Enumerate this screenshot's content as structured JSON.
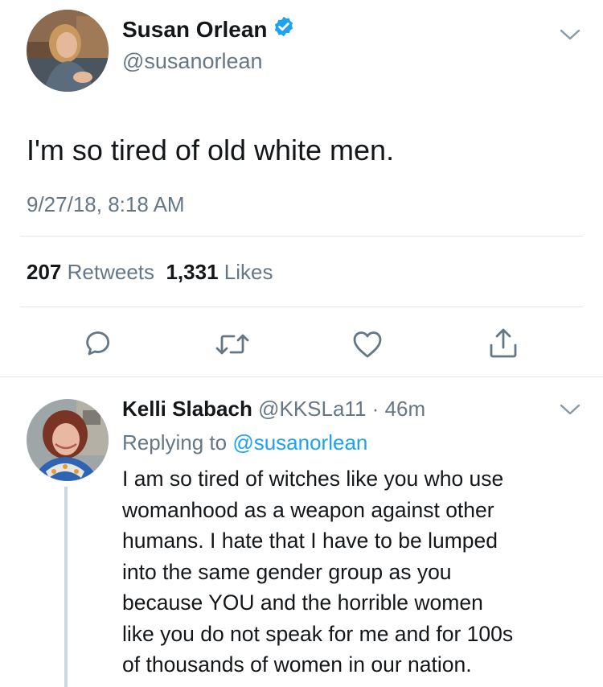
{
  "main_tweet": {
    "author_name": "Susan Orlean",
    "author_handle": "@susanorlean",
    "verified": true,
    "text": "I'm so tired of old white men.",
    "timestamp": "9/27/18, 8:18 AM",
    "retweet_count": "207",
    "retweet_label": "Retweets",
    "like_count": "1,331",
    "like_label": "Likes"
  },
  "actions": [
    "reply-icon",
    "retweet-icon",
    "like-icon",
    "share-icon"
  ],
  "reply": {
    "author_name": "Kelli Slabach",
    "author_handle": "@KKSLa11",
    "separator": "·",
    "time_ago": "46m",
    "replying_prefix": "Replying to",
    "replying_to": "@susanorlean",
    "text_lines": [
      "I am so tired of witches like you who use",
      "womanhood as a weapon against other",
      "humans. I hate that I have to be lumped",
      "into the same gender group as you",
      "because YOU and the horrible women",
      "like you do not speak for me and for 100s",
      "of thousands of women in our nation."
    ]
  },
  "colors": {
    "text_primary": "#14171a",
    "text_secondary": "#657786",
    "link": "#1da1f2",
    "divider": "#e1e8ed",
    "verified": "#1da1f2"
  }
}
